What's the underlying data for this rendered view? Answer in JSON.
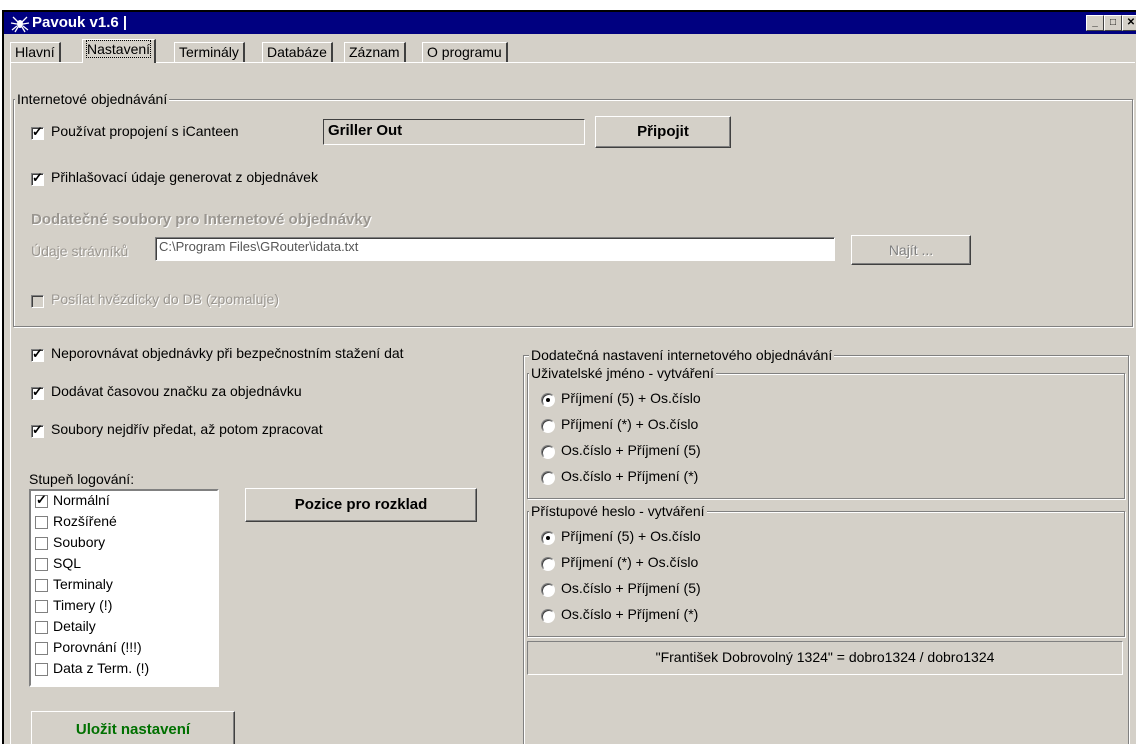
{
  "window": {
    "title": "Pavouk v1.6 |"
  },
  "tabs": [
    "Hlavní",
    "Nastavení",
    "Terminály",
    "Databáze",
    "Záznam",
    "O programu"
  ],
  "internet": {
    "group_title": "Internetové objednávání",
    "use_icanteen": "Používat propojení s iCanteen",
    "server_value": "Griller Out",
    "connect_button": "Připojit",
    "gen_login": "Přihlašovací údaje generovat z objednávek",
    "extra_files_title": "Dodatečné soubory pro Internetové objednávky",
    "diners_label": "Údaje strávníků",
    "diners_path": "C:\\Program Files\\GRouter\\idata.txt",
    "find_button": "Najít ...",
    "send_stars": "Posílat hvězdicky do DB (zpomaluje)"
  },
  "options": {
    "no_compare": "Neporovnávat objednávky při bezpečnostním stažení dat",
    "timestamp": "Dodávat časovou značku za objednávku",
    "files_first": "Soubory nejdřív předat, až potom zpracovat",
    "log_label": "Stupeň logování:",
    "log_items": [
      {
        "label": "Normální",
        "checked": true
      },
      {
        "label": "Rozšířené",
        "checked": false
      },
      {
        "label": "Soubory",
        "checked": false
      },
      {
        "label": "SQL",
        "checked": false
      },
      {
        "label": "Terminaly",
        "checked": false
      },
      {
        "label": "Timery (!)",
        "checked": false
      },
      {
        "label": "Detaily",
        "checked": false
      },
      {
        "label": "Porovnání (!!!)",
        "checked": false
      },
      {
        "label": "Data z Term. (!)",
        "checked": false
      }
    ],
    "position_button": "Pozice pro rozklad",
    "save_button": "Uložit nastavení"
  },
  "extra": {
    "group_title": "Dodatečná nastavení internetového objednávání",
    "username": {
      "title": "Uživatelské jméno - vytváření",
      "options": [
        "Příjmení (5) + Os.číslo",
        "Příjmení (*) + Os.číslo",
        "Os.číslo + Příjmení (5)",
        "Os.číslo + Příjmení (*)"
      ],
      "selected": 0
    },
    "password": {
      "title": "Přístupové heslo - vytváření",
      "options": [
        "Příjmení (5) + Os.číslo",
        "Příjmení (*) + Os.číslo",
        "Os.číslo + Příjmení (5)",
        "Os.číslo + Příjmení (*)"
      ],
      "selected": 0
    },
    "example": "\"František Dobrovolný 1324\"  = dobro1324 / dobro1324"
  },
  "colors": {
    "titlebar": "#000080",
    "face": "#d4d0c8",
    "save_text": "#007000"
  }
}
